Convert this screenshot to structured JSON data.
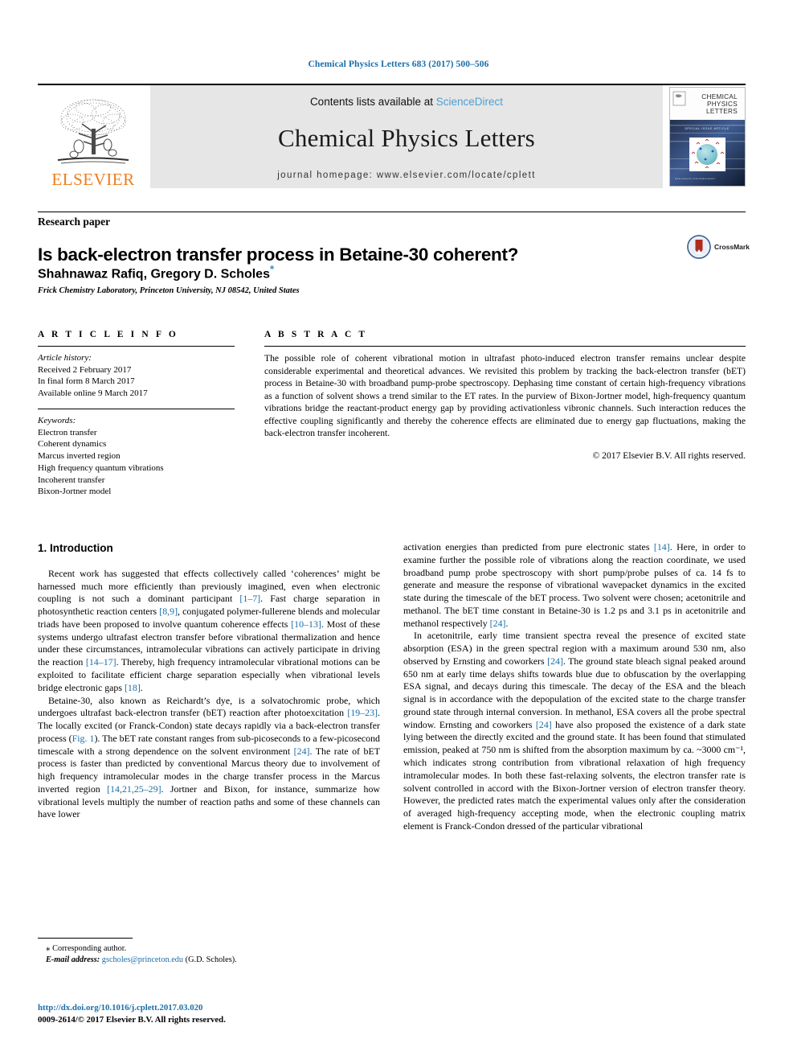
{
  "running_head": "Chemical Physics Letters 683 (2017) 500–506",
  "masthead": {
    "publisher_logo_text": "ELSEVIER",
    "contents_prefix": "Contents lists available at ",
    "sciencedirect": "ScienceDirect",
    "journal_name": "Chemical Physics Letters",
    "journal_homepage": "journal homepage: www.elsevier.com/locate/cplett",
    "cover_title_line1": "CHEMICAL",
    "cover_title_line2": "PHYSICS",
    "cover_title_line3": "LETTERS"
  },
  "article": {
    "type_label": "Research paper",
    "title": "Is back-electron transfer process in Betaine-30 coherent?",
    "authors": "Shahnawaz Rafiq, Gregory D. Scholes",
    "corresponding_marker": "*",
    "affiliation": "Frick Chemistry Laboratory, Princeton University, NJ 08542, United States",
    "crossmark_label": "CrossMark"
  },
  "article_info": {
    "heading": "A R T I C L E    I N F O",
    "history_label": "Article history:",
    "history": [
      "Received 2 February 2017",
      "In final form 8 March 2017",
      "Available online 9 March 2017"
    ],
    "keywords_label": "Keywords:",
    "keywords": [
      "Electron transfer",
      "Coherent dynamics",
      "Marcus inverted region",
      "High frequency quantum vibrations",
      "Incoherent transfer",
      "Bixon-Jortner model"
    ]
  },
  "abstract": {
    "heading": "A B S T R A C T",
    "text": "The possible role of coherent vibrational motion in ultrafast photo-induced electron transfer remains unclear despite considerable experimental and theoretical advances. We revisited this problem by tracking the back-electron transfer (bET) process in Betaine-30 with broadband pump-probe spectroscopy. Dephasing time constant of certain high-frequency vibrations as a function of solvent shows a trend similar to the ET rates. In the purview of Bixon-Jortner model, high-frequency quantum vibrations bridge the reactant-product energy gap by providing activationless vibronic channels. Such interaction reduces the effective coupling significantly and thereby the coherence effects are eliminated due to energy gap fluctuations, making the back-electron transfer incoherent.",
    "copyright": "© 2017 Elsevier B.V. All rights reserved."
  },
  "body": {
    "intro_heading": "1. Introduction",
    "left_paragraphs": [
      {
        "parts": [
          {
            "t": "Recent work has suggested that effects collectively called ‘coherences’ might be harnessed much more efficiently than previously imagined, even when electronic coupling is not such a dominant participant "
          },
          {
            "t": "[1–7]",
            "ref": true
          },
          {
            "t": ". Fast charge separation in photosynthetic reaction centers "
          },
          {
            "t": "[8,9]",
            "ref": true
          },
          {
            "t": ", conjugated polymer-fullerene blends and molecular triads have been proposed to involve quantum coherence effects "
          },
          {
            "t": "[10–13]",
            "ref": true
          },
          {
            "t": ". Most of these systems undergo ultrafast electron transfer before vibrational thermalization and hence under these circumstances, intramolecular vibrations can actively participate in driving the reaction "
          },
          {
            "t": "[14–17]",
            "ref": true
          },
          {
            "t": ". Thereby, high frequency intramolecular vibrational motions can be exploited to facilitate efficient charge separation especially when vibrational levels bridge electronic gaps "
          },
          {
            "t": "[18]",
            "ref": true
          },
          {
            "t": "."
          }
        ]
      },
      {
        "parts": [
          {
            "t": "Betaine-30, also known as Reichardt’s dye, is a solvatochromic probe, which undergoes ultrafast back-electron transfer (bET) reaction after photoexcitation "
          },
          {
            "t": "[19–23]",
            "ref": true
          },
          {
            "t": ". The locally excited (or Franck-Condon) state decays rapidly via a back-electron transfer process ("
          },
          {
            "t": "Fig. 1",
            "ref": true
          },
          {
            "t": "). The bET rate constant ranges from sub-picoseconds to a few-picosecond timescale with a strong dependence on the solvent environment "
          },
          {
            "t": "[24]",
            "ref": true
          },
          {
            "t": ". The rate of bET process is faster than predicted by conventional Marcus theory due to involvement of high frequency intramolecular modes in the charge transfer process in the Marcus inverted region "
          },
          {
            "t": "[14,21,25–29]",
            "ref": true
          },
          {
            "t": ". Jortner and Bixon, for instance, summarize how vibrational levels multiply the number of reaction paths and some of these channels can have lower"
          }
        ]
      }
    ],
    "right_paragraphs": [
      {
        "indent": false,
        "parts": [
          {
            "t": "activation energies than predicted from pure electronic states "
          },
          {
            "t": "[14]",
            "ref": true
          },
          {
            "t": ". Here, in order to examine further the possible role of vibrations along the reaction coordinate, we used broadband pump probe spectroscopy with short pump/probe pulses of ca. 14 fs to generate and measure the response of vibrational wavepacket dynamics in the excited state during the timescale of the bET process. Two solvent were chosen; acetonitrile and methanol. The bET time constant in Betaine-30 is 1.2 ps and 3.1 ps in acetonitrile and methanol respectively "
          },
          {
            "t": "[24]",
            "ref": true
          },
          {
            "t": "."
          }
        ]
      },
      {
        "indent": true,
        "parts": [
          {
            "t": "In acetonitrile, early time transient spectra reveal the presence of excited state absorption (ESA) in the green spectral region with a maximum around 530 nm, also observed by Ernsting and coworkers "
          },
          {
            "t": "[24]",
            "ref": true
          },
          {
            "t": ". The ground state bleach signal peaked around 650 nm at early time delays shifts towards blue due to obfuscation by the overlapping ESA signal, and decays during this timescale. The decay of the ESA and the bleach signal is in accordance with the depopulation of the excited state to the charge transfer ground state through internal conversion. In methanol, ESA covers all the probe spectral window. Ernsting and coworkers "
          },
          {
            "t": "[24]",
            "ref": true
          },
          {
            "t": " have also proposed the existence of a dark state lying between the directly excited and the ground state. It has been found that stimulated emission, peaked at 750 nm is shifted from the absorption maximum by ca. ~3000 cm⁻¹, which indicates strong contribution from vibrational relaxation of high frequency intramolecular modes. In both these fast-relaxing solvents, the electron transfer rate is solvent controlled in accord with the Bixon-Jortner version of electron transfer theory. However, the predicted rates match the experimental values only after the consideration of averaged high-frequency accepting mode, when the electronic coupling matrix element is Franck-Condon dressed of the particular vibrational"
          }
        ]
      }
    ]
  },
  "footnote": {
    "corresponding": "Corresponding author.",
    "email_label": "E-mail address:",
    "email": "gscholes@princeton.edu",
    "email_suffix": "(G.D. Scholes)."
  },
  "footer": {
    "doi": "http://dx.doi.org/10.1016/j.cplett.2017.03.020",
    "issn_line": "0009-2614/© 2017 Elsevier B.V. All rights reserved."
  },
  "colors": {
    "link": "#1a6ea8",
    "sciencedirect": "#4b9fd5",
    "elsevier_orange": "#ef7d1a",
    "banner_bg": "#e6e6e6"
  }
}
